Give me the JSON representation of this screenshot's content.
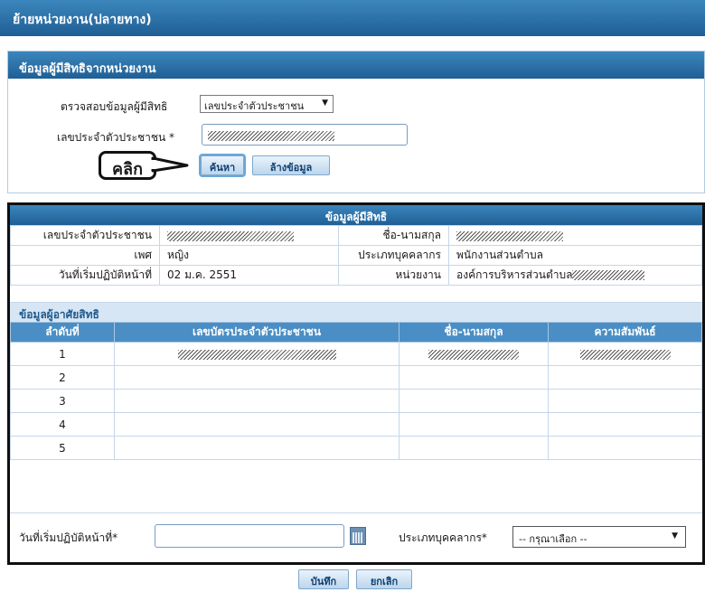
{
  "page": {
    "title": "ย้ายหน่วยงาน(ปลายทาง)"
  },
  "source_panel": {
    "heading": "ข้อมูลผู้มีสิทธิจากหน่วยงาน",
    "check_label": "ตรวจสอบข้อมูลผู้มีสิทธิ",
    "check_select_value": "เลขประจำตัวประชาชน",
    "id_label": "เลขประจำตัวประชาชน *",
    "search_button": "ค้นหา",
    "clear_button": "ล้างข้อมูล",
    "callout": "คลิก"
  },
  "entitle": {
    "heading": "ข้อมูลผู้มีสิทธิ",
    "id_label": "เลขประจำตัวประชาชน",
    "name_label": "ชื่อ-นามสกุล",
    "gender_label": "เพศ",
    "gender_value": "หญิง",
    "type_label": "ประเภทบุคคลากร",
    "type_value": "พนักงานส่วนตำบล",
    "start_label": "วันที่เริ่มปฏิบัติหน้าที่",
    "start_value": "02 ม.ค. 2551",
    "unit_label": "หน่วยงาน",
    "unit_value": "องค์การบริหารส่วนตำบล"
  },
  "dependents": {
    "heading": "ข้อมูลผู้อาศัยสิทธิ",
    "columns": [
      "ลำดับที่",
      "เลขบัตรประจำตัวประชาชน",
      "ชื่อ-นามสกุล",
      "ความสัมพันธ์"
    ],
    "rows": [
      "1",
      "2",
      "3",
      "4",
      "5"
    ]
  },
  "form": {
    "start_label": "วันที่เริ่มปฏิบัติหน้าที่*",
    "type_label": "ประเภทบุคคลากร*",
    "type_select": "-- กรุณาเลือก --"
  },
  "actions": {
    "save": "บันทึก",
    "cancel": "ยกเลิก"
  },
  "icons": {
    "calendar": "calendar-icon",
    "dropdown": "chevron-down-icon"
  }
}
